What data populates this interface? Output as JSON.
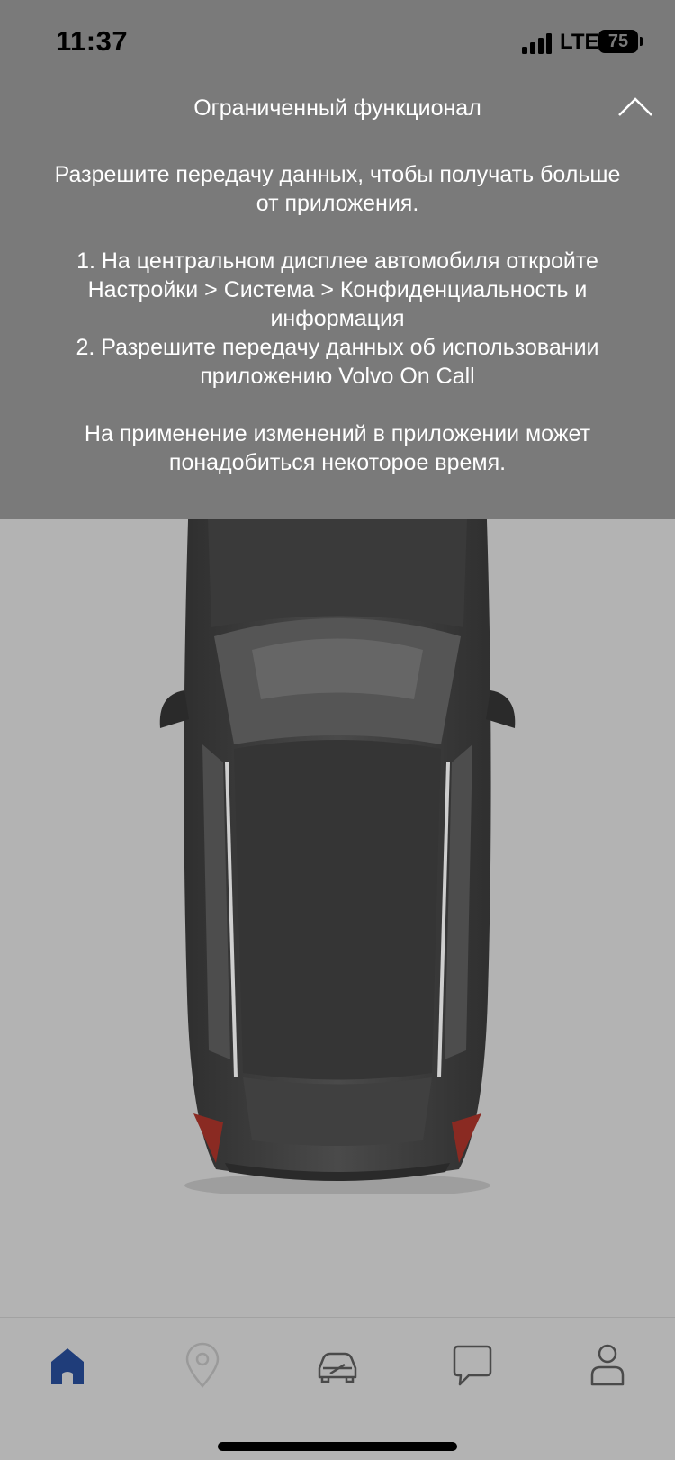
{
  "status_bar": {
    "time": "11:37",
    "network": "LTE",
    "battery": "75"
  },
  "banner": {
    "title": "Ограниченный функционал",
    "intro_line1": "Разрешите передачу данных, чтобы получать больше",
    "intro_line2": "от приложения.",
    "step1_line1": "1. На центральном дисплее автомобиля откройте",
    "step1_line2": "Настройки > Система > Конфиденциальность и",
    "step1_line3": "информация",
    "step2_line1": "2. Разрешите передачу данных об использовании",
    "step2_line2": "приложению Volvo On Call",
    "note_line1": "На применение изменений в приложении может",
    "note_line2": "понадобиться некоторое время."
  },
  "tab_bar": {
    "tabs": [
      {
        "name": "home",
        "icon": "home-icon",
        "active": true
      },
      {
        "name": "map",
        "icon": "location-pin-icon",
        "active": false
      },
      {
        "name": "car",
        "icon": "car-icon",
        "active": false
      },
      {
        "name": "messages",
        "icon": "chat-bubble-icon",
        "active": false
      },
      {
        "name": "profile",
        "icon": "person-icon",
        "active": false
      }
    ],
    "active_color": "#1f3d7a",
    "inactive_color": "#4a4a4a",
    "disabled_color": "#9a9a9a"
  },
  "colors": {
    "banner_background": "#7a7a7a",
    "screen_background": "#b3b3b3",
    "text": "#ffffff"
  }
}
